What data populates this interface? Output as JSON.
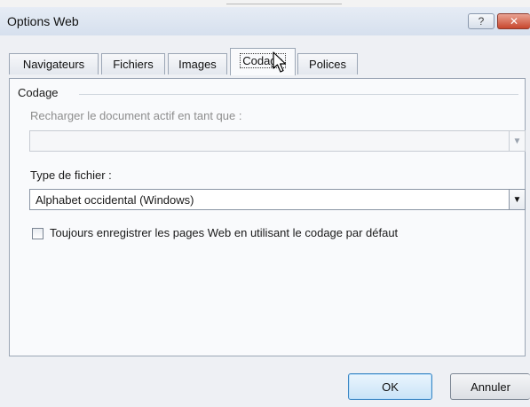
{
  "window": {
    "title": "Options Web",
    "help_label": "?",
    "close_label": "✕"
  },
  "tabs": [
    {
      "label": "Navigateurs"
    },
    {
      "label": "Fichiers"
    },
    {
      "label": "Images"
    },
    {
      "label": "Codage",
      "active": true
    },
    {
      "label": "Polices"
    }
  ],
  "panel": {
    "group_label": "Codage",
    "reload_label": "Recharger le document actif en tant que :",
    "reload_value": "",
    "filetype_label": "Type de fichier :",
    "filetype_value": "Alphabet occidental (Windows)",
    "always_save_label": "Toujours enregistrer les pages Web en utilisant le codage par défaut",
    "always_save_checked": false
  },
  "buttons": {
    "ok": "OK",
    "cancel": "Annuler"
  }
}
